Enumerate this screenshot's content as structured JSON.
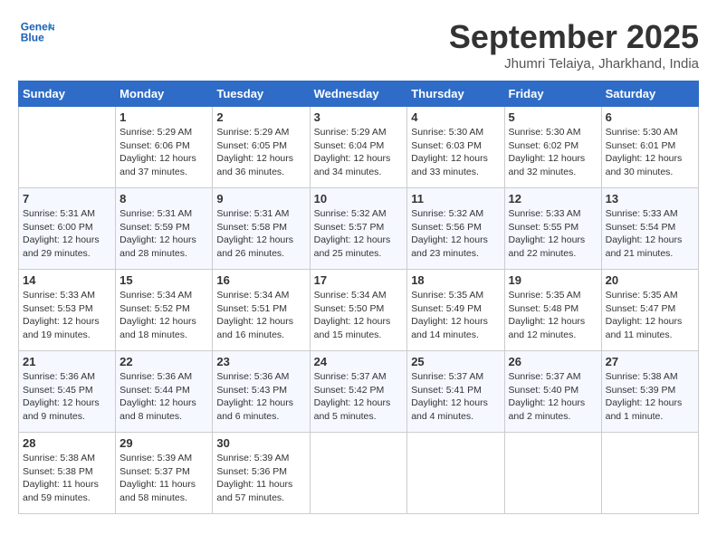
{
  "header": {
    "logo_line1": "General",
    "logo_line2": "Blue",
    "month_title": "September 2025",
    "location": "Jhumri Telaiya, Jharkhand, India"
  },
  "days_of_week": [
    "Sunday",
    "Monday",
    "Tuesday",
    "Wednesday",
    "Thursday",
    "Friday",
    "Saturday"
  ],
  "weeks": [
    [
      null,
      {
        "day": "1",
        "sunrise": "5:29 AM",
        "sunset": "6:06 PM",
        "daylight": "12 hours and 37 minutes."
      },
      {
        "day": "2",
        "sunrise": "5:29 AM",
        "sunset": "6:05 PM",
        "daylight": "12 hours and 36 minutes."
      },
      {
        "day": "3",
        "sunrise": "5:29 AM",
        "sunset": "6:04 PM",
        "daylight": "12 hours and 34 minutes."
      },
      {
        "day": "4",
        "sunrise": "5:30 AM",
        "sunset": "6:03 PM",
        "daylight": "12 hours and 33 minutes."
      },
      {
        "day": "5",
        "sunrise": "5:30 AM",
        "sunset": "6:02 PM",
        "daylight": "12 hours and 32 minutes."
      },
      {
        "day": "6",
        "sunrise": "5:30 AM",
        "sunset": "6:01 PM",
        "daylight": "12 hours and 30 minutes."
      }
    ],
    [
      {
        "day": "7",
        "sunrise": "5:31 AM",
        "sunset": "6:00 PM",
        "daylight": "12 hours and 29 minutes."
      },
      {
        "day": "8",
        "sunrise": "5:31 AM",
        "sunset": "5:59 PM",
        "daylight": "12 hours and 28 minutes."
      },
      {
        "day": "9",
        "sunrise": "5:31 AM",
        "sunset": "5:58 PM",
        "daylight": "12 hours and 26 minutes."
      },
      {
        "day": "10",
        "sunrise": "5:32 AM",
        "sunset": "5:57 PM",
        "daylight": "12 hours and 25 minutes."
      },
      {
        "day": "11",
        "sunrise": "5:32 AM",
        "sunset": "5:56 PM",
        "daylight": "12 hours and 23 minutes."
      },
      {
        "day": "12",
        "sunrise": "5:33 AM",
        "sunset": "5:55 PM",
        "daylight": "12 hours and 22 minutes."
      },
      {
        "day": "13",
        "sunrise": "5:33 AM",
        "sunset": "5:54 PM",
        "daylight": "12 hours and 21 minutes."
      }
    ],
    [
      {
        "day": "14",
        "sunrise": "5:33 AM",
        "sunset": "5:53 PM",
        "daylight": "12 hours and 19 minutes."
      },
      {
        "day": "15",
        "sunrise": "5:34 AM",
        "sunset": "5:52 PM",
        "daylight": "12 hours and 18 minutes."
      },
      {
        "day": "16",
        "sunrise": "5:34 AM",
        "sunset": "5:51 PM",
        "daylight": "12 hours and 16 minutes."
      },
      {
        "day": "17",
        "sunrise": "5:34 AM",
        "sunset": "5:50 PM",
        "daylight": "12 hours and 15 minutes."
      },
      {
        "day": "18",
        "sunrise": "5:35 AM",
        "sunset": "5:49 PM",
        "daylight": "12 hours and 14 minutes."
      },
      {
        "day": "19",
        "sunrise": "5:35 AM",
        "sunset": "5:48 PM",
        "daylight": "12 hours and 12 minutes."
      },
      {
        "day": "20",
        "sunrise": "5:35 AM",
        "sunset": "5:47 PM",
        "daylight": "12 hours and 11 minutes."
      }
    ],
    [
      {
        "day": "21",
        "sunrise": "5:36 AM",
        "sunset": "5:45 PM",
        "daylight": "12 hours and 9 minutes."
      },
      {
        "day": "22",
        "sunrise": "5:36 AM",
        "sunset": "5:44 PM",
        "daylight": "12 hours and 8 minutes."
      },
      {
        "day": "23",
        "sunrise": "5:36 AM",
        "sunset": "5:43 PM",
        "daylight": "12 hours and 6 minutes."
      },
      {
        "day": "24",
        "sunrise": "5:37 AM",
        "sunset": "5:42 PM",
        "daylight": "12 hours and 5 minutes."
      },
      {
        "day": "25",
        "sunrise": "5:37 AM",
        "sunset": "5:41 PM",
        "daylight": "12 hours and 4 minutes."
      },
      {
        "day": "26",
        "sunrise": "5:37 AM",
        "sunset": "5:40 PM",
        "daylight": "12 hours and 2 minutes."
      },
      {
        "day": "27",
        "sunrise": "5:38 AM",
        "sunset": "5:39 PM",
        "daylight": "12 hours and 1 minute."
      }
    ],
    [
      {
        "day": "28",
        "sunrise": "5:38 AM",
        "sunset": "5:38 PM",
        "daylight": "11 hours and 59 minutes."
      },
      {
        "day": "29",
        "sunrise": "5:39 AM",
        "sunset": "5:37 PM",
        "daylight": "11 hours and 58 minutes."
      },
      {
        "day": "30",
        "sunrise": "5:39 AM",
        "sunset": "5:36 PM",
        "daylight": "11 hours and 57 minutes."
      },
      null,
      null,
      null,
      null
    ]
  ]
}
